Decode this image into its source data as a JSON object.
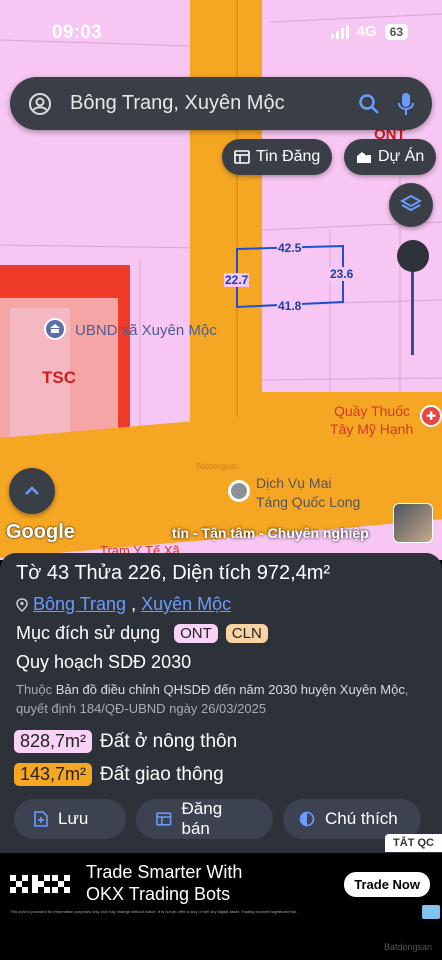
{
  "status": {
    "time": "09:03",
    "network": "4G",
    "battery": "63"
  },
  "search": {
    "query": "Bông Trang, Xuyên Mộc"
  },
  "buttons": {
    "listings": "Tin Đăng",
    "projects": "Dự Án"
  },
  "map": {
    "zones": {
      "ont": "ONT",
      "tsc": "TSC"
    },
    "dimensions": {
      "top": "42.5",
      "left": "22.7",
      "right": "23.6",
      "bottom": "41.8"
    },
    "pois": {
      "ubnd": "UBND xã Xuyên Mộc",
      "pharmacy_line1": "Quầy Thuốc",
      "pharmacy_line2": "Tây Mỹ Hạnh",
      "service_line1": "Dịch Vụ Mai",
      "service_line2": "Táng Quốc Long",
      "clinic": "Trạm Y Tế Xã"
    },
    "watermark": "Batdongsan",
    "google": "Google",
    "ticker": "tín - Tận tâm - Chuyên nghiệp"
  },
  "panel": {
    "title": "Tờ 43 Thửa 226, Diện tích 972,4m²",
    "location": {
      "commune": "Bông Trang",
      "separator": ",",
      "district": "Xuyên Mộc"
    },
    "purpose_label": "Mục đích sử dụng",
    "purpose_tags": [
      "ONT",
      "CLN"
    ],
    "plan": "Quy hoạch SDĐ 2030",
    "desc": {
      "prefix": "Thuộc",
      "source": "Bản đồ điều chỉnh QHSDĐ đến năm 2030 huyện Xuyên Mộc",
      "suffix": ", quyết định 184/QĐ-UBND ngày 26/03/2025"
    },
    "areas": [
      {
        "value": "828,7m²",
        "label": "Đất ở nông thôn",
        "color": "#f9d3f5"
      },
      {
        "value": "143,7m²",
        "label": "Đất giao thông",
        "color": "#f5a623"
      }
    ],
    "actions": {
      "save": "Lưu",
      "sell": "Đăng bán",
      "legend": "Chú thích"
    },
    "hide_ads": "TẮT QC"
  },
  "ad": {
    "brand": "OKX",
    "headline_line1": "Trade Smarter With",
    "headline_line2": "OKX Trading Bots",
    "cta": "Trade Now",
    "fine_print": "This post is provided for information purposes only and may change without notice. It is not an offer to buy or sell any digital asset. Trading involves significant risk."
  },
  "colors": {
    "map_bg": "#f7c6f2",
    "road": "#f5a623",
    "tsc": "#ee3b2a",
    "panel": "#2d3139",
    "link": "#6b9bff"
  }
}
